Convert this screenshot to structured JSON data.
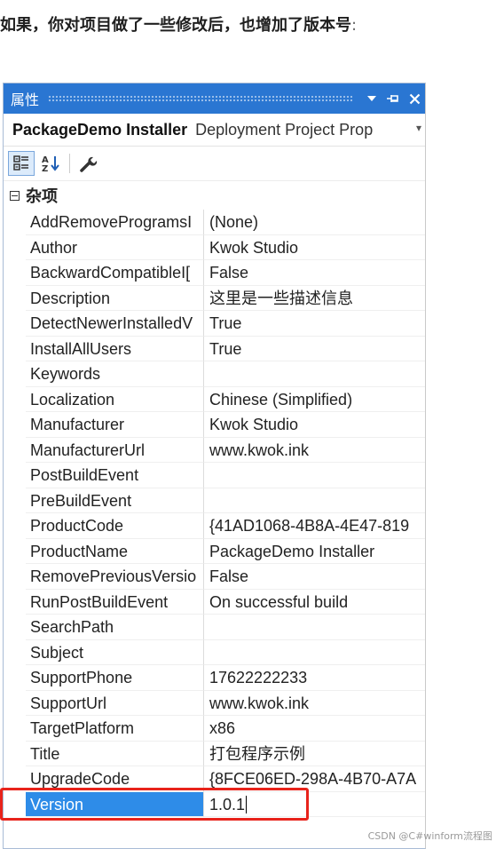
{
  "intro": {
    "text": "如果，你对项目做了一些修改后，也增加了版本号",
    "colon": ":"
  },
  "panel": {
    "title": "属性",
    "object_name": "PackageDemo Installer",
    "object_type": "Deployment Project Prop",
    "icons": [
      "categorized-icon",
      "alphabetical-icon",
      "property-pages-icon",
      "dropdown-icon",
      "pin-icon",
      "close-icon"
    ],
    "category": "杂项",
    "properties": [
      {
        "name": "AddRemoveProgramsI",
        "value": "(None)"
      },
      {
        "name": "Author",
        "value": "Kwok Studio"
      },
      {
        "name": "BackwardCompatibleI[",
        "value": "False"
      },
      {
        "name": "Description",
        "value": "这里是一些描述信息"
      },
      {
        "name": "DetectNewerInstalledV",
        "value": "True"
      },
      {
        "name": "InstallAllUsers",
        "value": "True"
      },
      {
        "name": "Keywords",
        "value": ""
      },
      {
        "name": "Localization",
        "value": "Chinese (Simplified)"
      },
      {
        "name": "Manufacturer",
        "value": "Kwok Studio"
      },
      {
        "name": "ManufacturerUrl",
        "value": "www.kwok.ink"
      },
      {
        "name": "PostBuildEvent",
        "value": ""
      },
      {
        "name": "PreBuildEvent",
        "value": ""
      },
      {
        "name": "ProductCode",
        "value": "{41AD1068-4B8A-4E47-819"
      },
      {
        "name": "ProductName",
        "value": "PackageDemo Installer"
      },
      {
        "name": "RemovePreviousVersio",
        "value": "False"
      },
      {
        "name": "RunPostBuildEvent",
        "value": "On successful build"
      },
      {
        "name": "SearchPath",
        "value": ""
      },
      {
        "name": "Subject",
        "value": ""
      },
      {
        "name": "SupportPhone",
        "value": "17622222233"
      },
      {
        "name": "SupportUrl",
        "value": "www.kwok.ink"
      },
      {
        "name": "TargetPlatform",
        "value": "x86"
      },
      {
        "name": "Title",
        "value": "打包程序示例"
      },
      {
        "name": "UpgradeCode",
        "value": "{8FCE06ED-298A-4B70-A7A"
      },
      {
        "name": "Version",
        "value": "1.0.1",
        "selected": true
      }
    ]
  },
  "watermark": "CSDN @C#winform流程图",
  "colors": {
    "titlebar": "#2a76d2",
    "selection": "#2e8ce8",
    "highlight_box": "#e8231b"
  }
}
